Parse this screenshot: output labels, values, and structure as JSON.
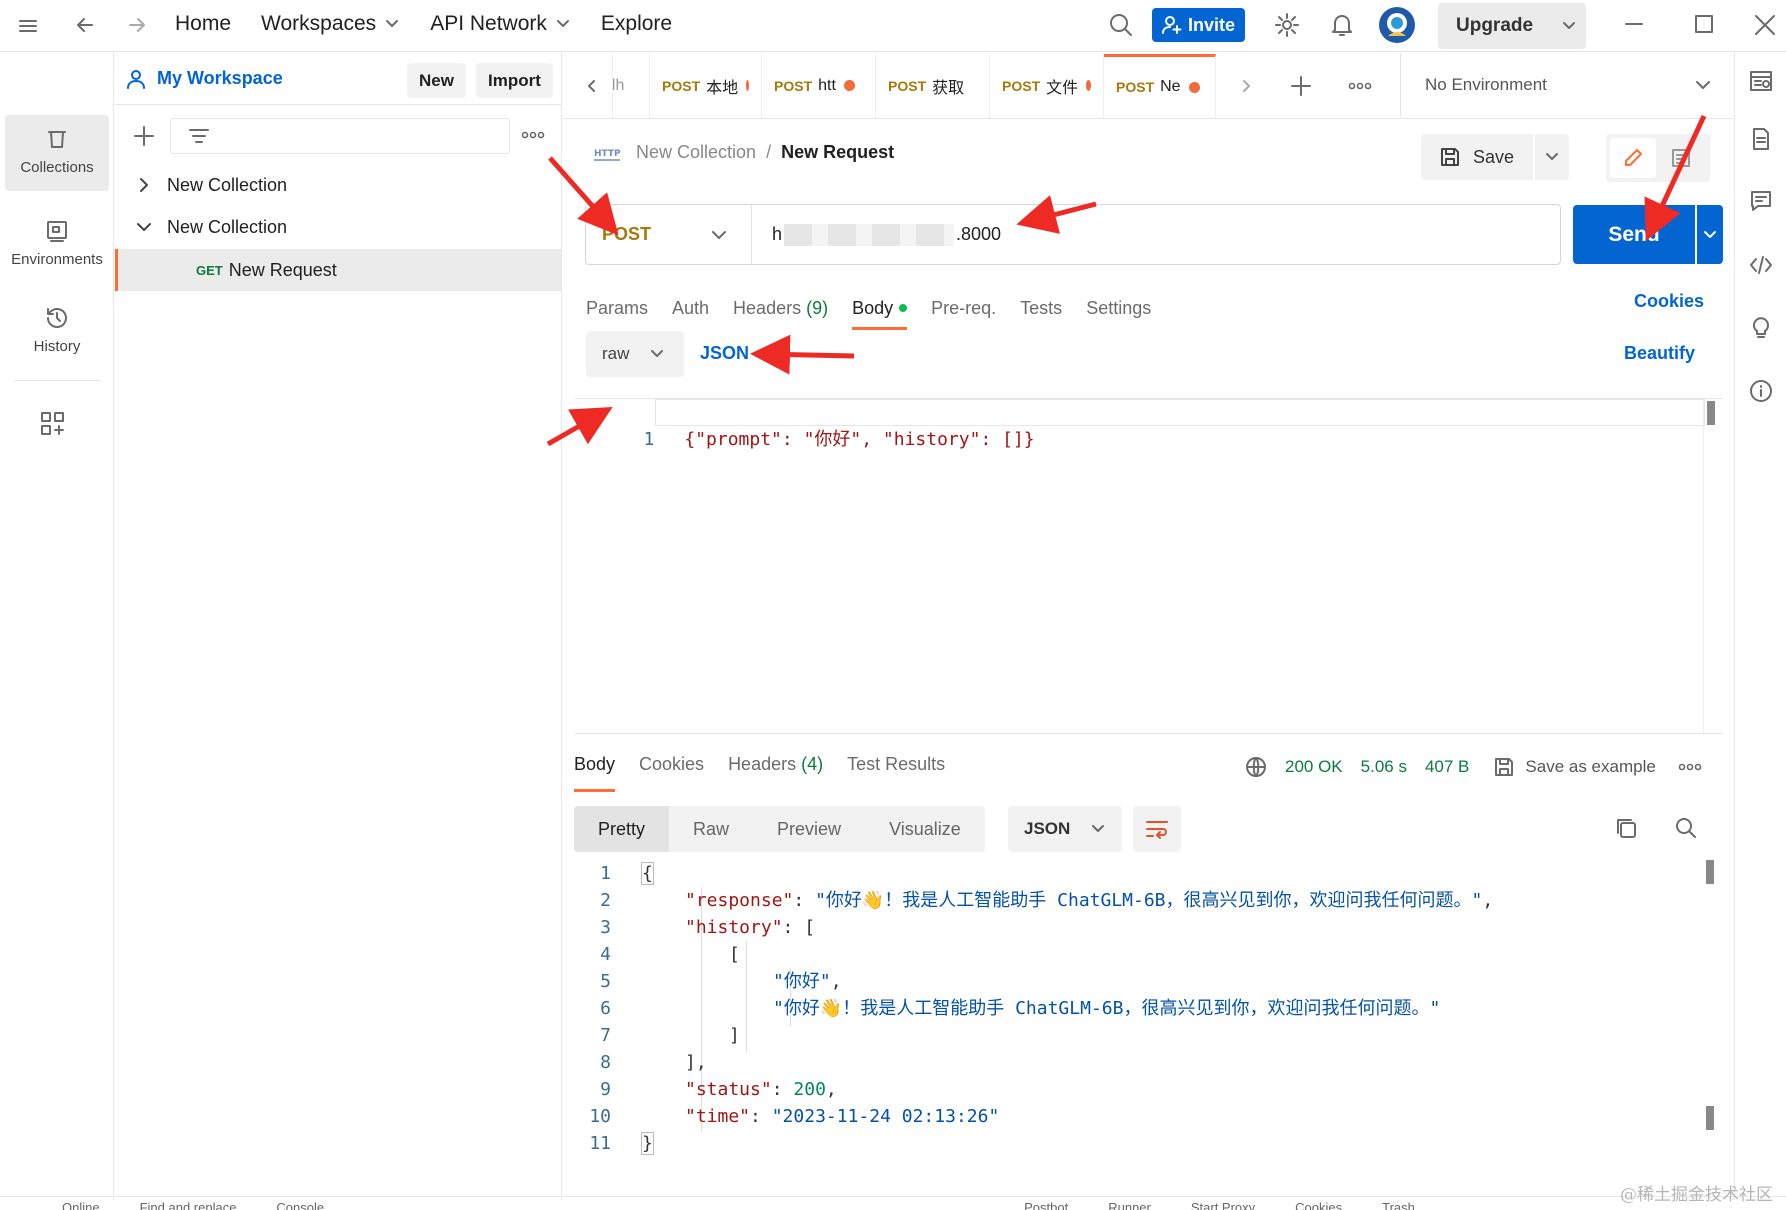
{
  "topbar": {
    "nav": [
      "Home",
      "Workspaces",
      "API Network",
      "Explore"
    ],
    "invite": "Invite",
    "upgrade": "Upgrade"
  },
  "rail": {
    "collections": "Collections",
    "environments": "Environments",
    "history": "History"
  },
  "sidebar": {
    "workspace": "My Workspace",
    "new": "New",
    "import": "Import",
    "tree": [
      {
        "label": "New Collection",
        "expanded": false
      },
      {
        "label": "New Collection",
        "expanded": true
      }
    ],
    "request": {
      "method": "GET",
      "label": "New Request"
    }
  },
  "tabs": [
    {
      "method": "",
      "label": "alh"
    },
    {
      "method": "POST",
      "label": "本地"
    },
    {
      "method": "POST",
      "label": "htt"
    },
    {
      "method": "POST",
      "label": "获取"
    },
    {
      "method": "POST",
      "label": "文件"
    },
    {
      "method": "POST",
      "label": "Ne"
    }
  ],
  "environment": "No Environment",
  "breadcrumb": {
    "collection": "New Collection",
    "sep": "/",
    "request": "New Request",
    "http": "HTTP"
  },
  "save": "Save",
  "request": {
    "method": "POST",
    "url_start": "h",
    "url_end": ".8000",
    "send": "Send"
  },
  "req_tabs": {
    "params": "Params",
    "auth": "Auth",
    "headers": "Headers",
    "headers_count": "(9)",
    "body": "Body",
    "prereq": "Pre-req.",
    "tests": "Tests",
    "settings": "Settings",
    "cookies": "Cookies"
  },
  "body_options": {
    "mode": "raw",
    "format": "JSON",
    "beautify": "Beautify"
  },
  "request_body": {
    "line": "1",
    "text": "{\"prompt\": \"你好\", \"history\": []}"
  },
  "response": {
    "tabs": {
      "body": "Body",
      "cookies": "Cookies",
      "headers": "Headers",
      "headers_count": "(4)",
      "tests": "Test Results"
    },
    "status": "200 OK",
    "time": "5.06 s",
    "size": "407 B",
    "save_example": "Save as example",
    "views": [
      "Pretty",
      "Raw",
      "Preview",
      "Visualize"
    ],
    "format": "JSON",
    "lines": [
      {
        "n": "1"
      },
      {
        "n": "2"
      },
      {
        "n": "3"
      },
      {
        "n": "4"
      },
      {
        "n": "5"
      },
      {
        "n": "6"
      },
      {
        "n": "7"
      },
      {
        "n": "8"
      },
      {
        "n": "9"
      },
      {
        "n": "10"
      },
      {
        "n": "11"
      }
    ],
    "json": {
      "response_key": "\"response\"",
      "response_val": "\"你好👋！我是人工智能助手 ChatGLM-6B，很高兴见到你，欢迎问我任何问题。\"",
      "history_key": "\"history\"",
      "hist_1": "\"你好\"",
      "hist_2": "\"你好👋！我是人工智能助手 ChatGLM-6B，很高兴见到你，欢迎问我任何问题。\"",
      "status_key": "\"status\"",
      "status_val": "200",
      "time_key": "\"time\"",
      "time_val": "\"2023-11-24 02:13:26\""
    }
  },
  "watermark": "@稀土掘金技术社区",
  "statusbar": [
    "Online",
    "Find and replace",
    "Console",
    "Postbot",
    "Runner",
    "Start Proxy",
    "Cookies",
    "Trash"
  ]
}
